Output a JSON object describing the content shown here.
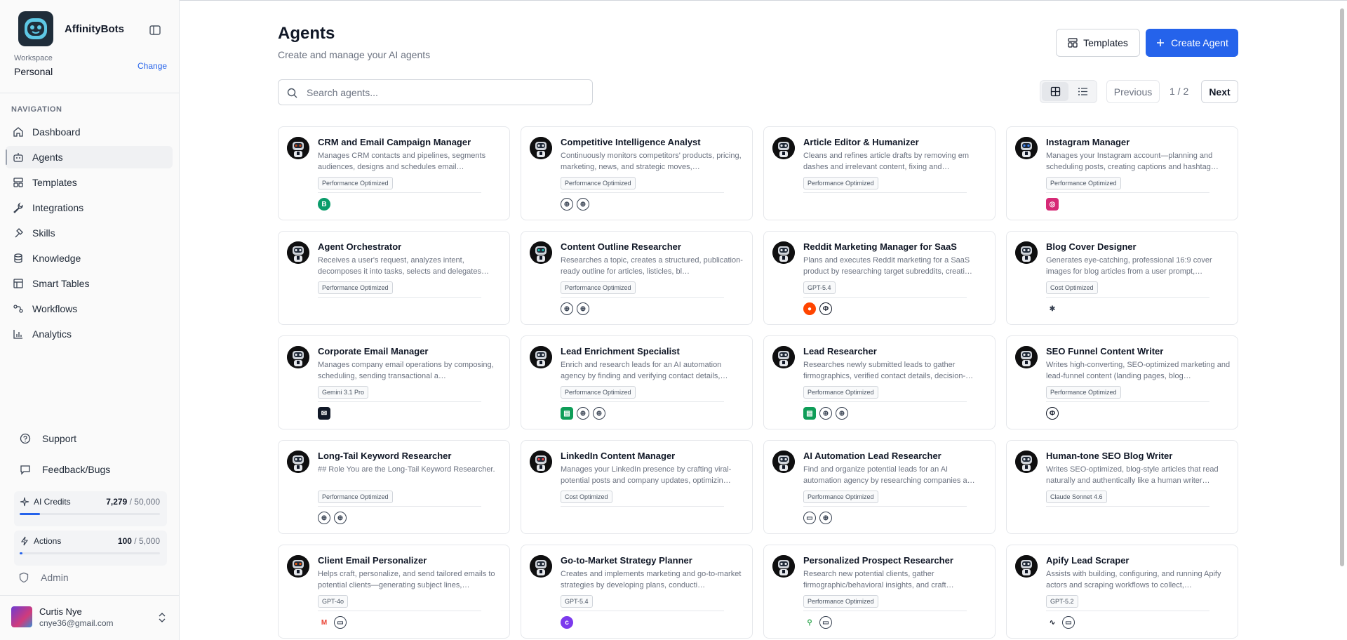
{
  "app": {
    "name": "AffinityBots"
  },
  "workspace": {
    "label": "Workspace",
    "name": "Personal",
    "change_label": "Change"
  },
  "nav": {
    "heading": "NAVIGATION",
    "items": [
      {
        "label": "Dashboard",
        "icon": "home-icon"
      },
      {
        "label": "Agents",
        "icon": "bot-icon",
        "active": true
      },
      {
        "label": "Templates",
        "icon": "layout-icon"
      },
      {
        "label": "Integrations",
        "icon": "wrench-icon"
      },
      {
        "label": "Skills",
        "icon": "lightning-icon"
      },
      {
        "label": "Knowledge",
        "icon": "database-icon"
      },
      {
        "label": "Smart Tables",
        "icon": "table-icon"
      },
      {
        "label": "Workflows",
        "icon": "workflow-icon"
      },
      {
        "label": "Analytics",
        "icon": "chart-icon"
      }
    ]
  },
  "support": {
    "support_label": "Support",
    "feedback_label": "Feedback/Bugs"
  },
  "usage": {
    "credits": {
      "label": "AI Credits",
      "used": "7,279",
      "total": "/ 50,000",
      "fraction": 0.146
    },
    "actions": {
      "label": "Actions",
      "used": "100",
      "total": "/ 5,000",
      "fraction": 0.02
    }
  },
  "admin_label": "Admin",
  "user": {
    "name": "Curtis Nye",
    "email": "cnye36@gmail.com"
  },
  "header": {
    "title": "Agents",
    "subtitle": "Create and manage your AI agents",
    "templates_label": "Templates",
    "create_label": "Create Agent"
  },
  "search": {
    "placeholder": "Search agents..."
  },
  "pager": {
    "previous": "Previous",
    "count": "1 / 2",
    "next": "Next"
  },
  "colors": {
    "primary": "#2563eb"
  },
  "agents": [
    {
      "title": "CRM and Email Campaign Manager",
      "desc": "Manages CRM contacts and pipelines, segments audiences, designs and schedules email…",
      "badge": "Performance Optimized",
      "tools": [
        "brevo-icon"
      ]
    },
    {
      "title": "Competitive Intelligence Analyst",
      "desc": "Continuously monitors competitors' products, pricing, marketing, news, and strategic moves,…",
      "badge": "Performance Optimized",
      "tools": [
        "globe-icon",
        "globe-icon"
      ]
    },
    {
      "title": "Article Editor & Humanizer",
      "desc": "Cleans and refines article drafts by removing em dashes and irrelevant content, fixing and…",
      "badge": "Performance Optimized",
      "tools": []
    },
    {
      "title": "Instagram Manager",
      "desc": "Manages your Instagram account—planning and scheduling posts, creating captions and hashtag…",
      "badge": "Performance Optimized",
      "tools": [
        "instagram-icon"
      ]
    },
    {
      "title": "Agent Orchestrator",
      "desc": "Receives a user's request, analyzes intent, decomposes it into tasks, selects and delegates…",
      "badge": "Performance Optimized",
      "tools": []
    },
    {
      "title": "Content Outline Researcher",
      "desc": "Researches a topic, creates a structured, publication-ready outline for articles, listicles, bl…",
      "badge": "Performance Optimized",
      "tools": [
        "globe-icon",
        "globe-icon"
      ]
    },
    {
      "title": "Reddit Marketing Manager for SaaS",
      "desc": "Plans and executes Reddit marketing for a SaaS product by researching target subreddits, creati…",
      "badge": "GPT-5.4",
      "tools": [
        "reddit-icon",
        "perplexity-icon"
      ]
    },
    {
      "title": "Blog Cover Designer",
      "desc": "Generates eye-catching, professional 16:9 cover images for blog articles from a user prompt,…",
      "badge": "Cost Optimized",
      "tools": [
        "sparkle-icon"
      ]
    },
    {
      "title": "Corporate Email Manager",
      "desc": "Manages company email operations by composing, scheduling, sending transactional a…",
      "badge": "Gemini 3.1 Pro",
      "tools": [
        "mail-app-icon"
      ]
    },
    {
      "title": "Lead Enrichment Specialist",
      "desc": "Enrich and research leads for an AI automation agency by finding and verifying contact details,…",
      "badge": "Performance Optimized",
      "tools": [
        "sheets-icon",
        "globe-icon",
        "globe-icon"
      ]
    },
    {
      "title": "Lead Researcher",
      "desc": "Researches newly submitted leads to gather firmographics, verified contact details, decision-…",
      "badge": "Performance Optimized",
      "tools": [
        "sheets-icon",
        "globe-icon",
        "globe-icon"
      ]
    },
    {
      "title": "SEO Funnel Content Writer",
      "desc": "Writes high-converting, SEO-optimized marketing and lead-funnel content (landing pages, blog…",
      "badge": "Performance Optimized",
      "tools": [
        "perplexity-icon"
      ]
    },
    {
      "title": "Long-Tail Keyword Researcher",
      "desc": "## Role You are the Long-Tail Keyword Researcher.",
      "badge": "Performance Optimized",
      "tools": [
        "globe-icon",
        "globe-icon"
      ]
    },
    {
      "title": "LinkedIn Content Manager",
      "desc": "Manages your LinkedIn presence by crafting viral-potential posts and company updates, optimizin…",
      "badge": "Cost Optimized",
      "tools": []
    },
    {
      "title": "AI Automation Lead Researcher",
      "desc": "Find and organize potential leads for an AI automation agency by researching companies a…",
      "badge": "Performance Optimized",
      "tools": [
        "document-icon",
        "globe-icon"
      ]
    },
    {
      "title": "Human-tone SEO Blog Writer",
      "desc": "Writes SEO-optimized, blog-style articles that read naturally and authentically like a human writer…",
      "badge": "Claude Sonnet 4.6",
      "tools": []
    },
    {
      "title": "Client Email Personalizer",
      "desc": "Helps craft, personalize, and send tailored emails to potential clients—generating subject lines,…",
      "badge": "GPT-4o",
      "tools": [
        "gmail-icon",
        "document-icon"
      ]
    },
    {
      "title": "Go-to-Market Strategy Planner",
      "desc": "Creates and implements marketing and go-to-market strategies by developing plans, conducti…",
      "badge": "GPT-5.4",
      "tools": [
        "canva-icon"
      ]
    },
    {
      "title": "Personalized Prospect Researcher",
      "desc": "Research new potential clients, gather firmographic/behavioral insights, and craft…",
      "badge": "Performance Optimized",
      "tools": [
        "maps-icon",
        "document-icon"
      ]
    },
    {
      "title": "Apify Lead Scraper",
      "desc": "Assists with building, configuring, and running Apify actors and scraping workflows to collect,…",
      "badge": "GPT-5.2",
      "tools": [
        "apify-icon",
        "document-icon"
      ]
    }
  ]
}
